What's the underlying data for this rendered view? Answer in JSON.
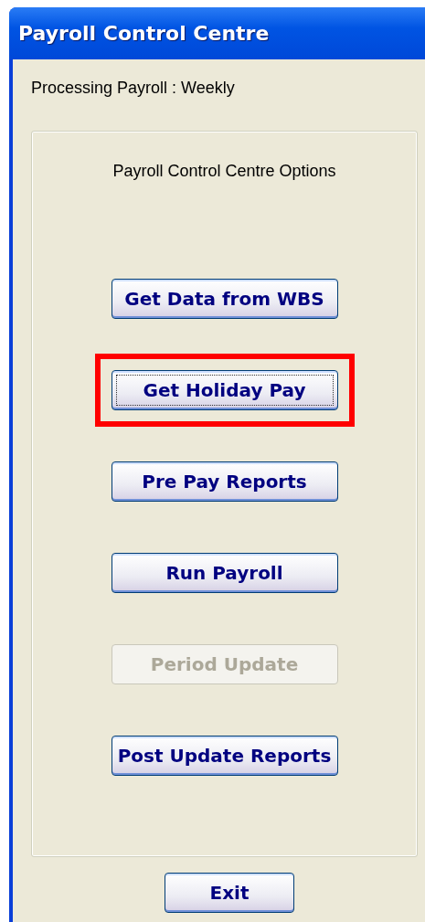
{
  "window": {
    "title": "Payroll Control Centre"
  },
  "status": "Processing Payroll : Weekly",
  "group": {
    "title": "Payroll Control Centre Options",
    "buttons": [
      {
        "label": "Get Data from WBS",
        "disabled": false,
        "focused": false,
        "highlighted": false
      },
      {
        "label": "Get Holiday Pay",
        "disabled": false,
        "focused": true,
        "highlighted": true
      },
      {
        "label": "Pre Pay Reports",
        "disabled": false,
        "focused": false,
        "highlighted": false
      },
      {
        "label": "Run Payroll",
        "disabled": false,
        "focused": false,
        "highlighted": false
      },
      {
        "label": "Period Update",
        "disabled": true,
        "focused": false,
        "highlighted": false
      },
      {
        "label": "Post Update Reports",
        "disabled": false,
        "focused": false,
        "highlighted": false
      }
    ]
  },
  "exit_button": {
    "label": "Exit"
  }
}
